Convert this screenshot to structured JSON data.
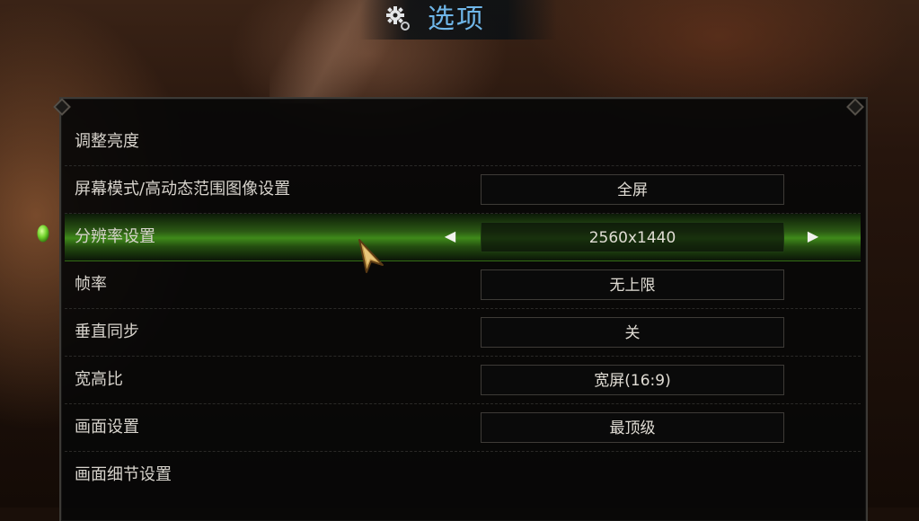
{
  "header": {
    "title": "选项",
    "icon": "gear-icon",
    "title_color": "#6fb6e8"
  },
  "options": [
    {
      "id": "brightness",
      "label": "调整亮度",
      "value": null
    },
    {
      "id": "screen-mode",
      "label": "屏幕模式/高动态范围图像设置",
      "value": "全屏"
    },
    {
      "id": "resolution",
      "label": "分辨率设置",
      "value": "2560x1440",
      "selected": true
    },
    {
      "id": "frame-rate",
      "label": "帧率",
      "value": "无上限"
    },
    {
      "id": "vsync",
      "label": "垂直同步",
      "value": "关"
    },
    {
      "id": "aspect-ratio",
      "label": "宽高比",
      "value": "宽屏(16:9)"
    },
    {
      "id": "graphics",
      "label": "画面设置",
      "value": "最顶级"
    },
    {
      "id": "graphics-detail",
      "label": "画面细节设置",
      "value": null
    }
  ],
  "selected_row_color": "#3f8a1a",
  "arrows": {
    "left": "◀",
    "right": "▶"
  },
  "icons": {
    "selection": "green-gem-icon",
    "pointer": "cursor-icon"
  }
}
